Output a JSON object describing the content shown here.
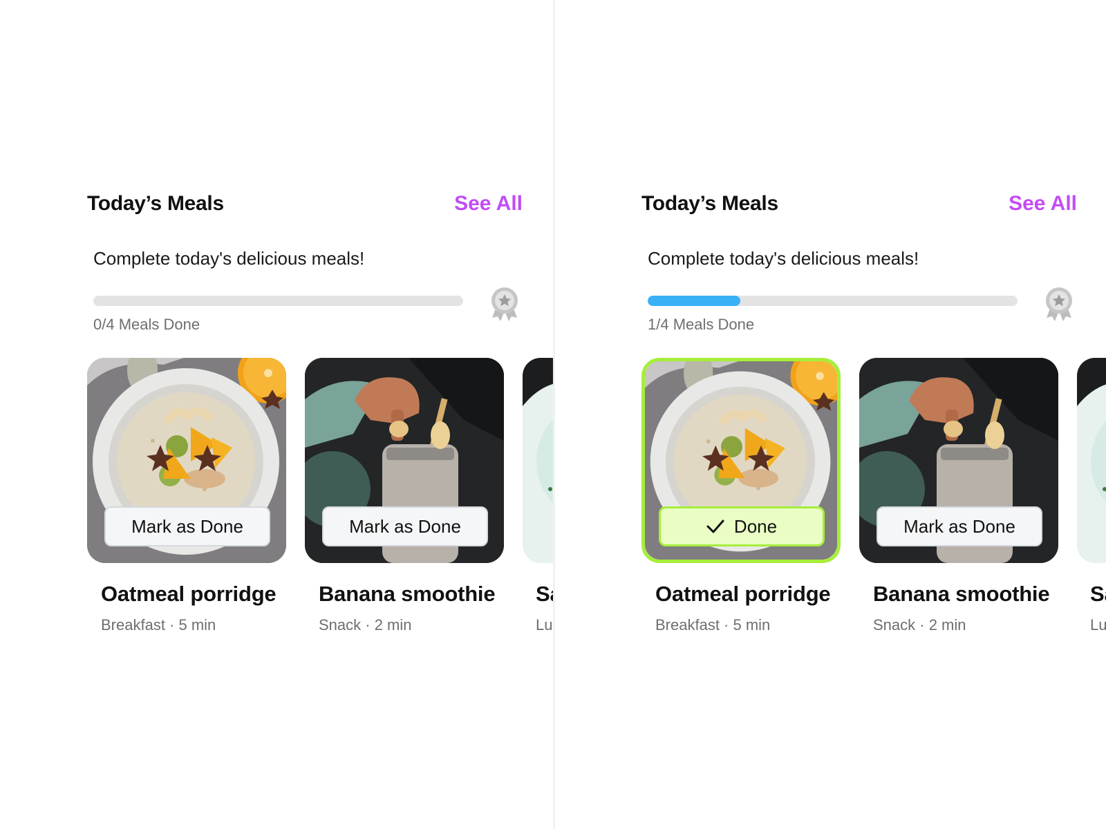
{
  "colors": {
    "accent": "#c24cf6",
    "progress_fill": "#3ab0f7",
    "done_border": "#a6ee3a",
    "done_bg": "#e9fdc4"
  },
  "panels": [
    {
      "title": "Today’s Meals",
      "see_all": "See All",
      "subtitle": "Complete today's delicious meals!",
      "progress": {
        "done": 0,
        "total": 4,
        "label": "0/4 Meals Done"
      },
      "badge_icon": "award-ribbon-icon",
      "meals": [
        {
          "name": "Oatmeal porridge",
          "meta": "Breakfast · 5 min",
          "button": "Mark as Done",
          "completed": false,
          "image": "oatmeal-bowl-photo"
        },
        {
          "name": "Banana smoothie",
          "meta": "Snack · 2 min",
          "button": "Mark as Done",
          "completed": false,
          "image": "banana-smoothie-photo"
        },
        {
          "name": "Sa",
          "meta": "Lu",
          "image": "salad-photo"
        }
      ]
    },
    {
      "title": "Today’s Meals",
      "see_all": "See All",
      "subtitle": "Complete today's delicious meals!",
      "progress": {
        "done": 1,
        "total": 4,
        "label": "1/4 Meals Done"
      },
      "badge_icon": "award-ribbon-icon",
      "meals": [
        {
          "name": "Oatmeal porridge",
          "meta": "Breakfast · 5 min",
          "button": "Done",
          "completed": true,
          "image": "oatmeal-bowl-photo"
        },
        {
          "name": "Banana smoothie",
          "meta": "Snack · 2 min",
          "button": "Mark as Done",
          "completed": false,
          "image": "banana-smoothie-photo"
        },
        {
          "name": "Sa",
          "meta": "Lu",
          "image": "salad-photo"
        }
      ]
    }
  ]
}
